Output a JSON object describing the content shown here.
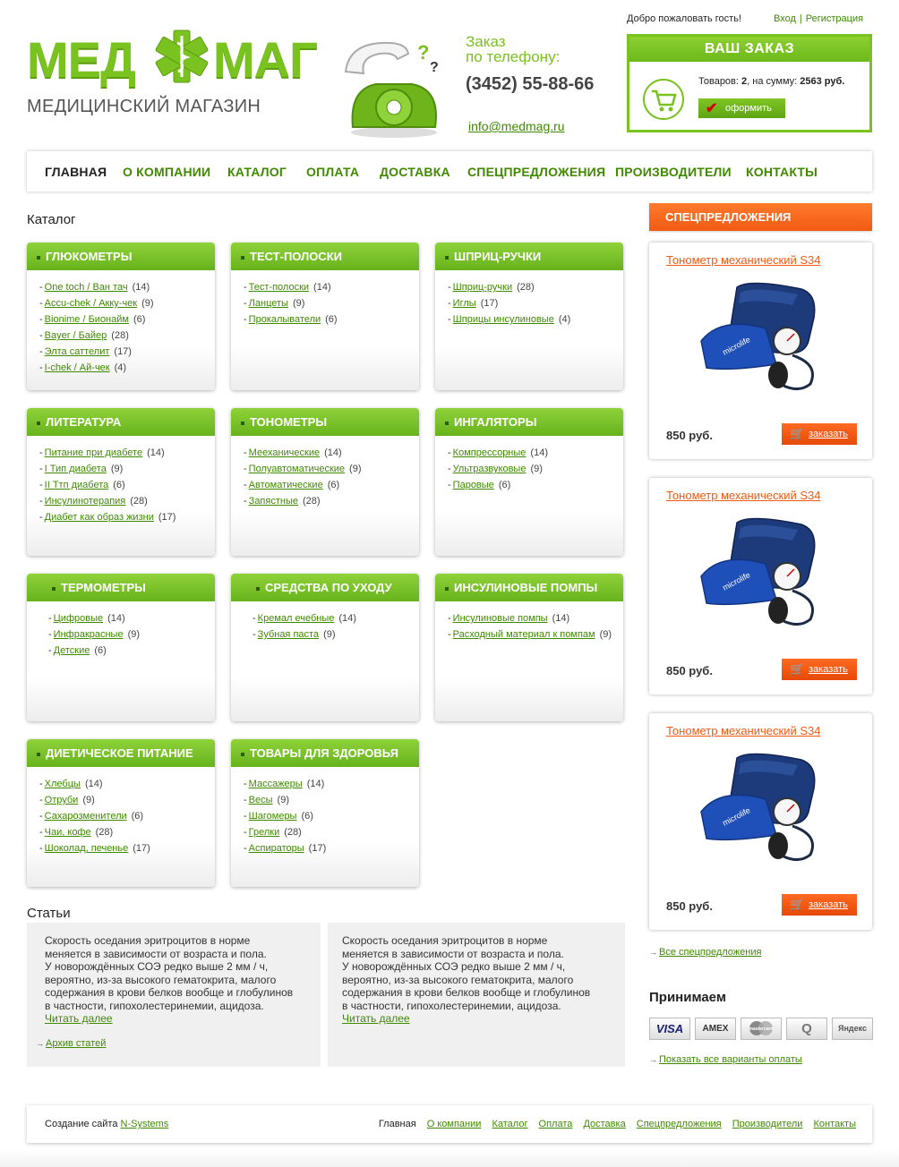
{
  "header": {
    "logo_part1": "МЕД",
    "logo_part2": "МАГ",
    "tagline": "МЕДИЦИНСКИЙ МАГАЗИН",
    "order_line1": "Заказ",
    "order_line2": "по телефону:",
    "phone": "(3452) 55-88-66",
    "email": "info@medmag.ru",
    "welcome": "Добро пожаловать гость!",
    "login": "Вход",
    "register": "Регистрация",
    "separator": "|"
  },
  "cart": {
    "title": "ВАШ ЗАКАЗ",
    "items_label": "Товаров:",
    "items_count": "2",
    "sum_label": ", на сумму:",
    "sum": "2563 руб.",
    "checkout_label": "оформить"
  },
  "nav": {
    "items": [
      "Главная",
      "О компании",
      "Каталог",
      "Оплата",
      "Доставка",
      "Спецпредложения",
      "Производители",
      "Контакты"
    ]
  },
  "catalog": {
    "title": "Каталог",
    "categories": [
      {
        "title": "ГЛЮКОМЕТРЫ",
        "items": [
          {
            "label": "One toch / Ван тач",
            "count": "(14)"
          },
          {
            "label": "Accu-chek / Акку-чек",
            "count": "(9)"
          },
          {
            "label": "Bionime / Бионайм",
            "count": "(6)"
          },
          {
            "label": "Bayer / Байер",
            "count": "(28)"
          },
          {
            "label": "Элта саттелит",
            "count": "(17)"
          },
          {
            "label": "I-chek / Ай-чек",
            "count": "(4)"
          }
        ]
      },
      {
        "title": "ТЕСТ-ПОЛОСКИ",
        "items": [
          {
            "label": "Тест-полоски",
            "count": "(14)"
          },
          {
            "label": "Ланцеты",
            "count": "(9)"
          },
          {
            "label": "Прокалыватели",
            "count": "(6)"
          }
        ]
      },
      {
        "title": "ШПРИЦ-РУЧКИ",
        "items": [
          {
            "label": "Шприц-ручки",
            "count": "(28)"
          },
          {
            "label": "Иглы",
            "count": "(17)"
          },
          {
            "label": "Шприцы инсулиновые",
            "count": "(4)"
          }
        ]
      },
      {
        "title": "ЛИТЕРАТУРА",
        "items": [
          {
            "label": "Питание при диабете",
            "count": "(14)"
          },
          {
            "label": "I Тип диабета",
            "count": "(9)"
          },
          {
            "label": "II Ттп диабета",
            "count": "(6)"
          },
          {
            "label": "Инсулинотерапия",
            "count": "(28)"
          },
          {
            "label": "Диабет как образ жизни",
            "count": "(17)"
          }
        ]
      },
      {
        "title": "ТОНОМЕТРЫ",
        "items": [
          {
            "label": "Мееханические",
            "count": "(14)"
          },
          {
            "label": "Полуавтоматические",
            "count": "(9)"
          },
          {
            "label": "Автоматические",
            "count": "(6)"
          },
          {
            "label": "Запястные",
            "count": "(28)"
          }
        ]
      },
      {
        "title": "ИНГАЛЯТОРЫ",
        "items": [
          {
            "label": "Компрессорные",
            "count": "(14)"
          },
          {
            "label": "Ультразвуковые",
            "count": "(9)"
          },
          {
            "label": "Паровые",
            "count": "(6)"
          }
        ]
      },
      {
        "title": "ТЕРМОМЕТРЫ",
        "items": [
          {
            "label": "Цифровые",
            "count": "(14)"
          },
          {
            "label": "Инфракрасные",
            "count": "(9)"
          },
          {
            "label": "Детские",
            "count": "(6)"
          }
        ]
      },
      {
        "title": "СРЕДСТВА ПО УХОДУ",
        "items": [
          {
            "label": "Кремал ечебные",
            "count": "(14)"
          },
          {
            "label": "Зубная паста",
            "count": "(9)"
          }
        ]
      },
      {
        "title": "ИНСУЛИНОВЫЕ ПОМПЫ",
        "items": [
          {
            "label": "Инсулиновые помпы",
            "count": "(14)"
          },
          {
            "label": "Расходный материал к помпам",
            "count": "(9)"
          }
        ]
      },
      {
        "title": "ДИЕТИЧЕСКОЕ ПИТАНИЕ",
        "items": [
          {
            "label": "Хлебцы",
            "count": "(14)"
          },
          {
            "label": "Отруби",
            "count": "(9)"
          },
          {
            "label": "Сахарозменители",
            "count": "(6)"
          },
          {
            "label": "Чаи, кофе",
            "count": "(28)"
          },
          {
            "label": "Шоколад, печенье",
            "count": "(17)"
          }
        ]
      },
      {
        "title": "ТОВАРЫ ДЛЯ ЗДОРОВЬЯ",
        "items": [
          {
            "label": "Массажеры",
            "count": "(14)"
          },
          {
            "label": "Весы",
            "count": "(9)"
          },
          {
            "label": "Шагомеры",
            "count": "(6)"
          },
          {
            "label": "Грелки",
            "count": "(28)"
          },
          {
            "label": "Аспираторы",
            "count": "(17)"
          }
        ]
      }
    ]
  },
  "articles": {
    "title": "Статьи",
    "items": [
      {
        "lines": [
          "Скорость оседания эритроцитов в норме",
          "меняется в зависимости от возраста и пола.",
          "У новорождённых СОЭ редко выше 2 мм / ч,",
          "вероятно, из-за высокого гематокрита, малого",
          "содержания в крови белков вообще и глобулинов",
          "в частности, гипохолестеринемии, ацидоза."
        ],
        "more": "Читать далее"
      },
      {
        "lines": [
          "Скорость оседания эритроцитов в норме",
          "меняется в зависимости от возраста и пола.",
          "У новорождённых СОЭ редко выше 2 мм / ч,",
          "вероятно, из-за высокого гематокрита, малого",
          "содержания в крови белков вообще и глобулинов",
          "в частности, гипохолестеринемии, ацидоза."
        ],
        "more": "Читать далее"
      }
    ],
    "archive": "Архив статей"
  },
  "offers": {
    "title": "СПЕЦПРЕДЛОЖЕНИЯ",
    "items": [
      {
        "title": "Тонометр механический S34",
        "price": "850 руб.",
        "button": "заказать"
      },
      {
        "title": "Тонометр механический S34",
        "price": "850 руб.",
        "button": "заказать"
      },
      {
        "title": "Тонометр механический S34",
        "price": "850 руб.",
        "button": "заказать"
      }
    ],
    "all": "Все спецпредложения"
  },
  "payment": {
    "title": "Принимаем",
    "methods": [
      "VISA",
      "AMEX",
      "mastercard",
      "Q",
      "Яндекс"
    ],
    "all": "Показать все варианты оплаты"
  },
  "footer": {
    "credit": "Создание сайта",
    "credit_link": "N-Systems",
    "links": [
      "Главная",
      "О компании",
      "Каталог",
      "Оплата",
      "Доставка",
      "Спецпредложения",
      "Производители",
      "Контакты"
    ]
  },
  "colors": {
    "brand_green": "#7ac21f",
    "link_green": "#3f8a00",
    "accent_orange": "#f15a12"
  }
}
